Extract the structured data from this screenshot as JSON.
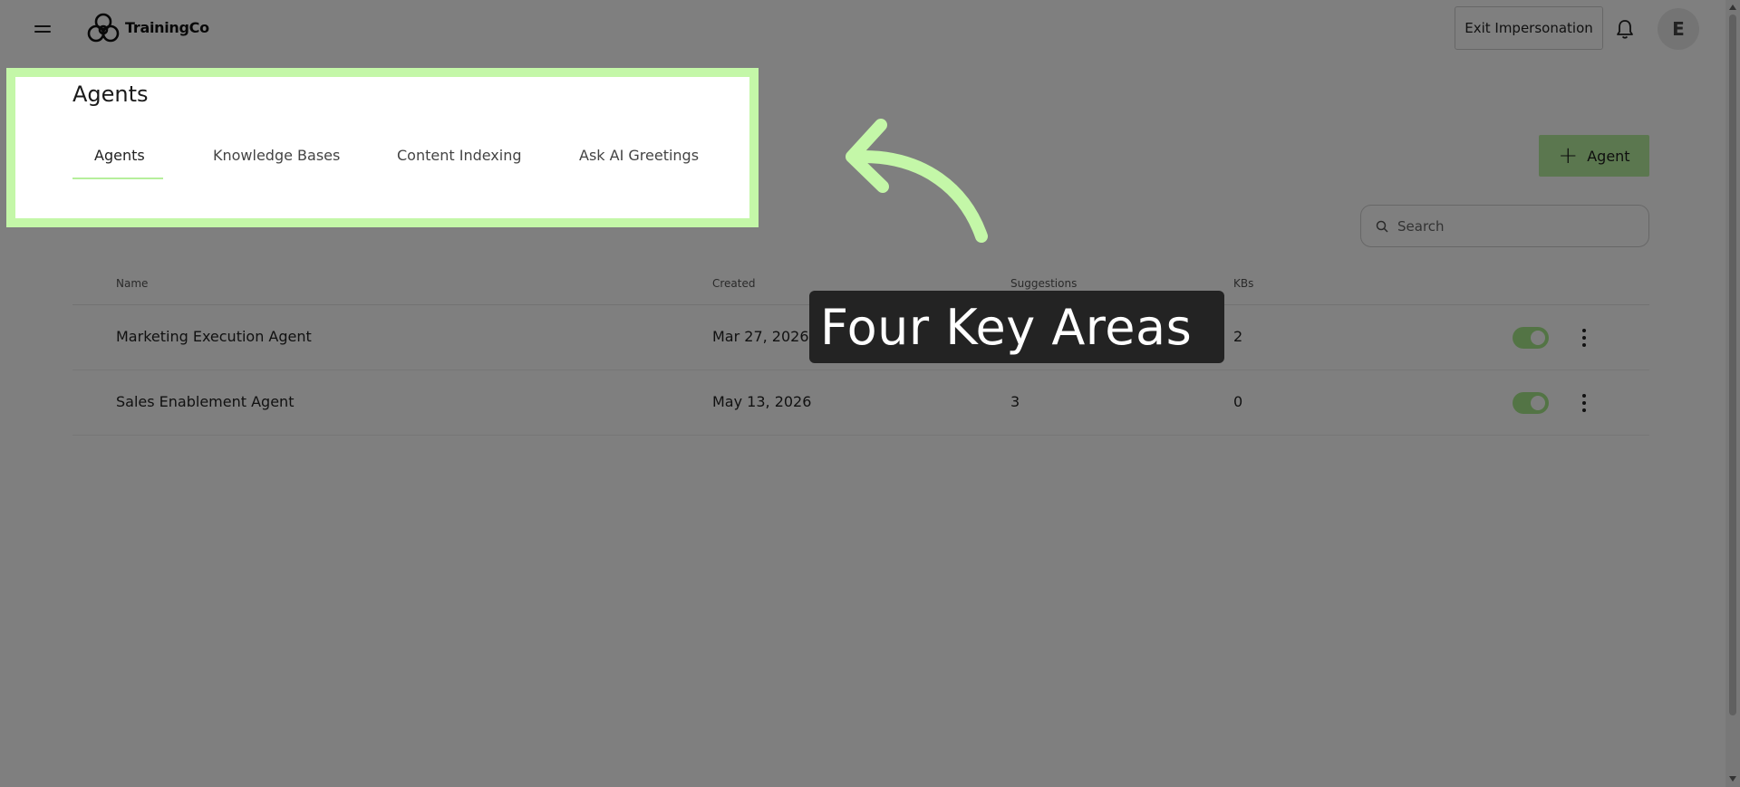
{
  "header": {
    "brand_name": "TrainingCo",
    "exit_impersonation_label": "Exit Impersonation",
    "avatar_initial": "E"
  },
  "page": {
    "title": "Agents",
    "tabs": [
      {
        "label": "Agents",
        "active": true
      },
      {
        "label": "Knowledge Bases",
        "active": false
      },
      {
        "label": "Content Indexing",
        "active": false
      },
      {
        "label": "Ask AI Greetings",
        "active": false
      }
    ],
    "add_button_label": "Agent"
  },
  "search": {
    "placeholder": "Search"
  },
  "table": {
    "columns": [
      "Name",
      "Created",
      "Suggestions",
      "KBs"
    ],
    "rows": [
      {
        "name": "Marketing Execution Agent",
        "created": "Mar 27, 2026",
        "suggestions": "",
        "kbs": "2",
        "enabled": true
      },
      {
        "name": "Sales Enablement Agent",
        "created": "May 13, 2026",
        "suggestions": "3",
        "kbs": "0",
        "enabled": true
      }
    ]
  },
  "callout": {
    "text": "Four Key Areas"
  },
  "colors": {
    "accent_green": "#b7ef9e",
    "highlight_border": "#c4f7a8",
    "callout_bg": "#232323"
  },
  "icons": [
    "menu-icon",
    "logo-icon",
    "bell-icon",
    "plus-icon",
    "search-icon",
    "kebab-menu-icon",
    "arrow-icon"
  ]
}
